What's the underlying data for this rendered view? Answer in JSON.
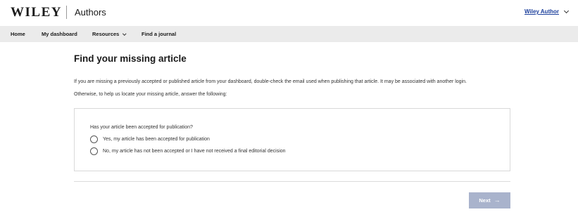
{
  "header": {
    "logo": "WILEY",
    "section": "Authors",
    "user_name": "Wiley Author",
    "user_chevron_icon": "chevron-down-icon"
  },
  "nav": {
    "items": [
      {
        "label": "Home"
      },
      {
        "label": "My dashboard"
      },
      {
        "label": "Resources",
        "has_dropdown": true
      },
      {
        "label": "Find a journal"
      }
    ]
  },
  "main": {
    "title": "Find your missing article",
    "paragraph1": "If you are missing a previously accepted or published article from your dashboard, double-check the email used when publishing that article. It may be associated with another login.",
    "paragraph2": "Otherwise, to help us locate your missing article, answer the following:",
    "question": "Has your article been accepted for publication?",
    "options": [
      {
        "label": "Yes, my article has been accepted for publication",
        "selected": false
      },
      {
        "label": "No, my article has not been accepted or I have not received a final editorial decision",
        "selected": false
      }
    ],
    "next_label": "Next",
    "next_icon": "arrow-right-icon"
  },
  "colors": {
    "nav_background": "#ebebeb",
    "link": "#1c3f9c",
    "next_button_disabled": "#a9b3cc"
  }
}
